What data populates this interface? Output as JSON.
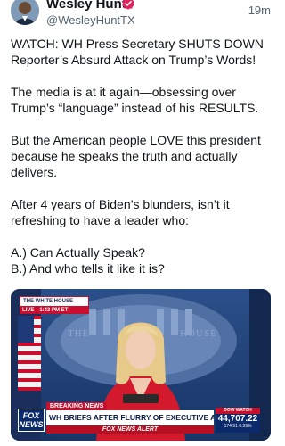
{
  "author": {
    "display_name": "Wesley Hunt",
    "handle": "@WesleyHuntTX",
    "verified": true,
    "verified_color": "#e0245e"
  },
  "post": {
    "time": "19m",
    "paragraphs": [
      "WATCH: WH Press Secretary SHUTS DOWN Reporter’s Absurd Attack on Trump’s Words!",
      "The media is at it again—obsessing over Trump’s “language” instead of his RESULTS.",
      "But the American people LOVE this president because he speaks the truth and actually delivers.",
      "After 4 years of Biden’s blunders, isn’t it refreshing to have a leader who:",
      "A.) Can Actually Speak?\nB.) And who tells it like it is?"
    ]
  },
  "video": {
    "wh_badge": "THE WHITE HOUSE",
    "live_label": "LIVE",
    "live_time": "1:43 PM ET",
    "backdrop_left": "THE",
    "backdrop_right": "HOUSE",
    "breaking_label": "BREAKING NEWS",
    "network_logo": "FOX NEWS",
    "headline": "WH BRIEFS AFTER FLURRY OF EXECUTIVE ACTION",
    "alert_bar": "FOX NEWS ALERT",
    "dow_label": "DOW WATCH",
    "dow_value": "44,707.22",
    "dow_change": "174.91 0.39%"
  },
  "colors": {
    "text_primary": "#0f1419",
    "text_secondary": "#536471",
    "fox_red": "#c8102e",
    "fox_navy": "#0a2a6b"
  }
}
